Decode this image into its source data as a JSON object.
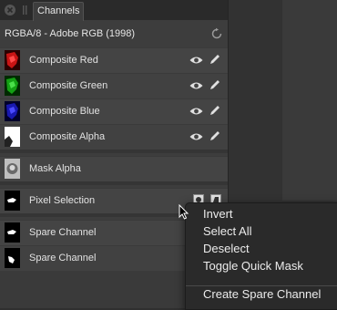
{
  "panel": {
    "tab_label": "Channels",
    "header_title": "RGBA/8 - Adobe RGB (1998)"
  },
  "channels": [
    {
      "label": "Composite Red"
    },
    {
      "label": "Composite Green"
    },
    {
      "label": "Composite Blue"
    },
    {
      "label": "Composite Alpha"
    },
    {
      "label": "Mask Alpha"
    },
    {
      "label": "Pixel Selection"
    },
    {
      "label": "Spare Channel"
    },
    {
      "label": "Spare Channel"
    }
  ],
  "context_menu": {
    "items": [
      "Invert",
      "Select All",
      "Deselect",
      "Toggle Quick Mask",
      "Create Spare Channel"
    ]
  },
  "icons": {
    "close": "close-icon",
    "refresh": "refresh-icon",
    "visibility": "eye-icon",
    "edit": "pencil-icon",
    "cursor": "cursor-icon"
  },
  "colors": {
    "panel_bg": "#3d3d3d",
    "row_bg": "#444444",
    "menu_bg": "#2a2a2a"
  }
}
